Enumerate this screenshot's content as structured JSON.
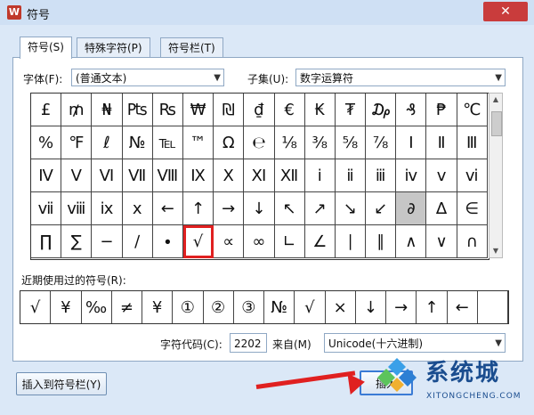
{
  "window": {
    "title": "符号",
    "close_glyph": "✕"
  },
  "tabs": [
    {
      "label": "符号(S)",
      "active": true
    },
    {
      "label": "特殊字符(P)",
      "active": false
    },
    {
      "label": "符号栏(T)",
      "active": false
    }
  ],
  "font": {
    "label": "字体(F):",
    "value": "(普通文本)"
  },
  "subset": {
    "label": "子集(U):",
    "value": "数字运算符"
  },
  "symbols": [
    "£",
    "₥",
    "₦",
    "₧",
    "₨",
    "₩",
    "₪",
    "₫",
    "€",
    "₭",
    "₮",
    "₯",
    "₰",
    "₱",
    "℃",
    "%",
    "℉",
    "ℓ",
    "№",
    "℡",
    "™",
    "Ω",
    "℮",
    "⅛",
    "⅜",
    "⅝",
    "⅞",
    "Ⅰ",
    "Ⅱ",
    "Ⅲ",
    "Ⅳ",
    "Ⅴ",
    "Ⅵ",
    "Ⅶ",
    "Ⅷ",
    "Ⅸ",
    "Ⅹ",
    "Ⅺ",
    "Ⅻ",
    "ⅰ",
    "ⅱ",
    "ⅲ",
    "ⅳ",
    "ⅴ",
    "ⅵ",
    "ⅶ",
    "ⅷ",
    "ⅸ",
    "ⅹ",
    "←",
    "↑",
    "→",
    "↓",
    "↖",
    "↗",
    "↘",
    "↙",
    "∂",
    "∆",
    "∈",
    "∏",
    "∑",
    "−",
    "∕",
    "∙",
    "√",
    "∝",
    "∞",
    "∟",
    "∠",
    "∣",
    "∥",
    "∧",
    "∨",
    "∩"
  ],
  "selected_symbol_index": 57,
  "highlighted_symbol_index": 65,
  "recent": {
    "label": "近期使用过的符号(R):",
    "items": [
      "√",
      "¥",
      "‰",
      "≠",
      "¥",
      "①",
      "②",
      "③",
      "№",
      "√",
      "×",
      "↓",
      "→",
      "↑",
      "←",
      ""
    ]
  },
  "char_code": {
    "label": "字符代码(C):",
    "value": "2202"
  },
  "from": {
    "label": "来自(M)",
    "value": "Unicode(十六进制)"
  },
  "buttons": {
    "insert_to_bar": "插入到符号栏(Y)",
    "insert": "插入"
  },
  "watermark": {
    "cn": "系统城",
    "en": "XITONGCHENG.COM"
  },
  "colors": {
    "annotation_red": "#e02020",
    "selected_cell": "#c6c6c6",
    "watermark_blue": "#1a4d8f"
  }
}
